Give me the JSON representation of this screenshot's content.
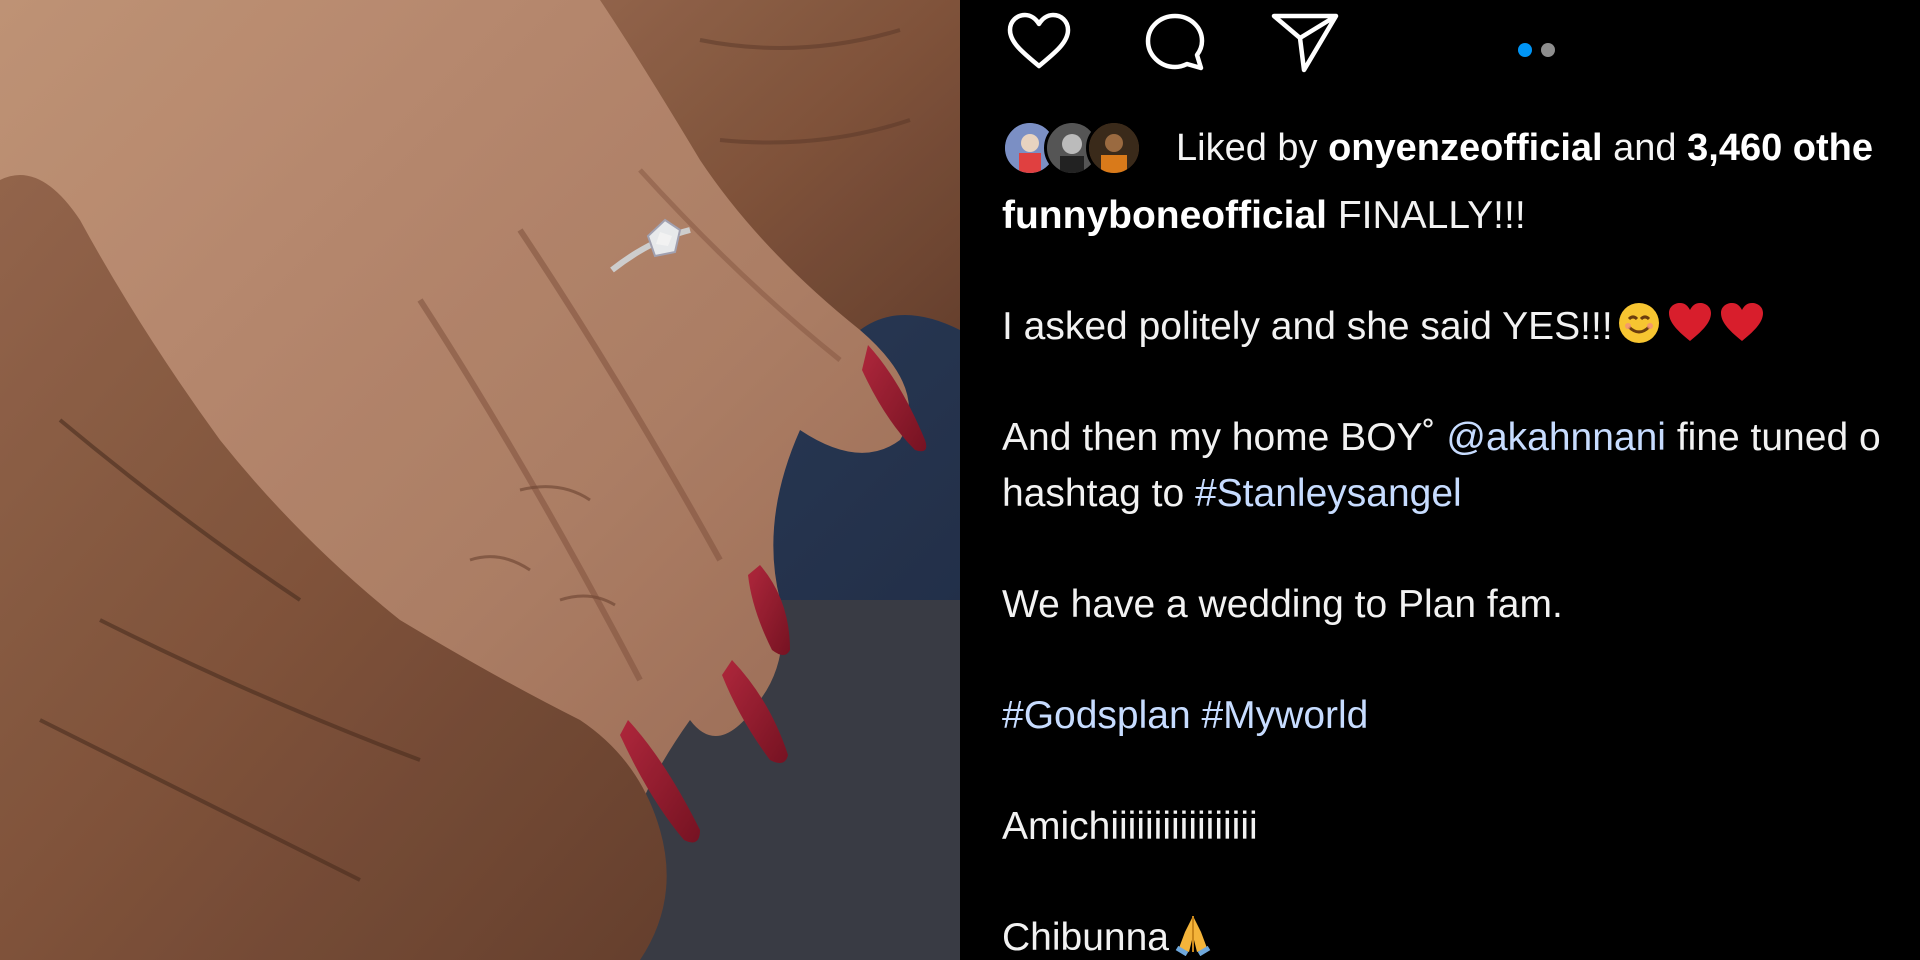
{
  "post": {
    "pager": {
      "total": 2,
      "active": 0
    },
    "likes": {
      "prefix": "Liked by ",
      "user": "onyenzeofficial",
      "middle": " and ",
      "count": "3,460 othe"
    },
    "caption": {
      "username": "funnyboneofficial",
      "line1_text": " FINALLY!!!",
      "line2": "I asked politely and she said YES!!!",
      "line2_emojis": [
        "smiling-face-emoji",
        "red-heart-emoji",
        "red-heart-emoji"
      ],
      "line3_a": "And then my home BOY",
      "line3_mark": "˚",
      "line3_mention": "@akahnnani",
      "line3_b": " fine tuned o",
      "line4_a": "hashtag to ",
      "line4_tag": "#Stanleysangel",
      "line5": "We have a wedding to Plan fam.",
      "line6_tag1": "#Godsplan",
      "line6_tag2": "#Myworld",
      "line7": "Amichiiiiiiiiiiiiiiiii",
      "line8": "Chibunna",
      "line8_emoji": "folded-hands-emoji"
    }
  },
  "colors": {
    "background": "#000000",
    "text": "#f5f5f5",
    "link": "#c7dcff",
    "pager_active": "#0095f6",
    "pager_inactive": "#8e8e8e",
    "nail_polish": "#9b1b2e"
  }
}
